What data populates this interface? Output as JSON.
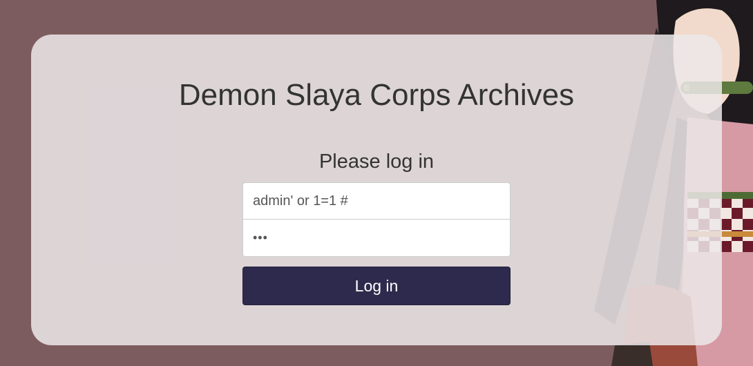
{
  "page": {
    "title": "Demon Slaya Corps Archives",
    "subtitle": "Please log in"
  },
  "form": {
    "username_value": "admin' or 1=1 #",
    "password_value": "abc",
    "login_label": "Log in"
  },
  "colors": {
    "background": "#7d5c60",
    "card": "#ece8e9",
    "button": "#2e2a4d",
    "text": "#333333"
  },
  "background_art": "anime-character-illustration"
}
